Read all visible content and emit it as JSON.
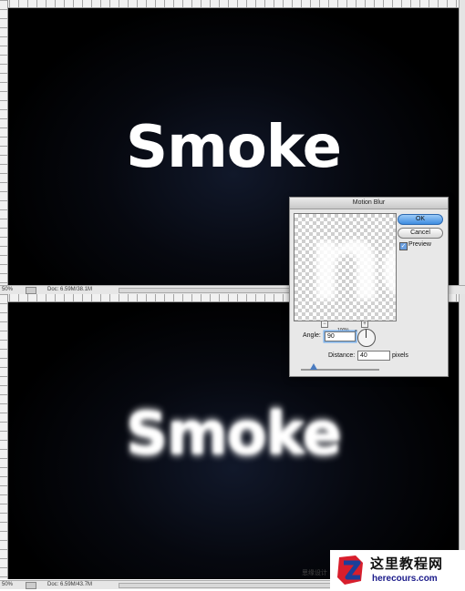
{
  "top_window": {
    "text": "Smoke",
    "status": {
      "zoom": "50%",
      "doc": "Doc: 6.59M/38.1M"
    }
  },
  "bottom_window": {
    "text": "Smoke",
    "status": {
      "zoom": "50%",
      "doc": "Doc: 6.59M/43.7M"
    }
  },
  "dialog": {
    "title": "Motion Blur",
    "ok_label": "OK",
    "cancel_label": "Cancel",
    "preview_label": "Preview",
    "preview_checked": true,
    "zoom_level": "100%",
    "zoom_out": "−",
    "zoom_in": "+",
    "angle_label": "Angle:",
    "angle_value": "90",
    "angle_unit": "°",
    "distance_label": "Distance:",
    "distance_value": "40",
    "distance_unit": "pixels",
    "distance_slider_fraction": 0.16
  },
  "watermark": {
    "cn": "这里教程网",
    "url": "herecours.com",
    "small": "思缘设计"
  },
  "colors": {
    "accent": "#3f8de0",
    "canvas": "#000000"
  }
}
